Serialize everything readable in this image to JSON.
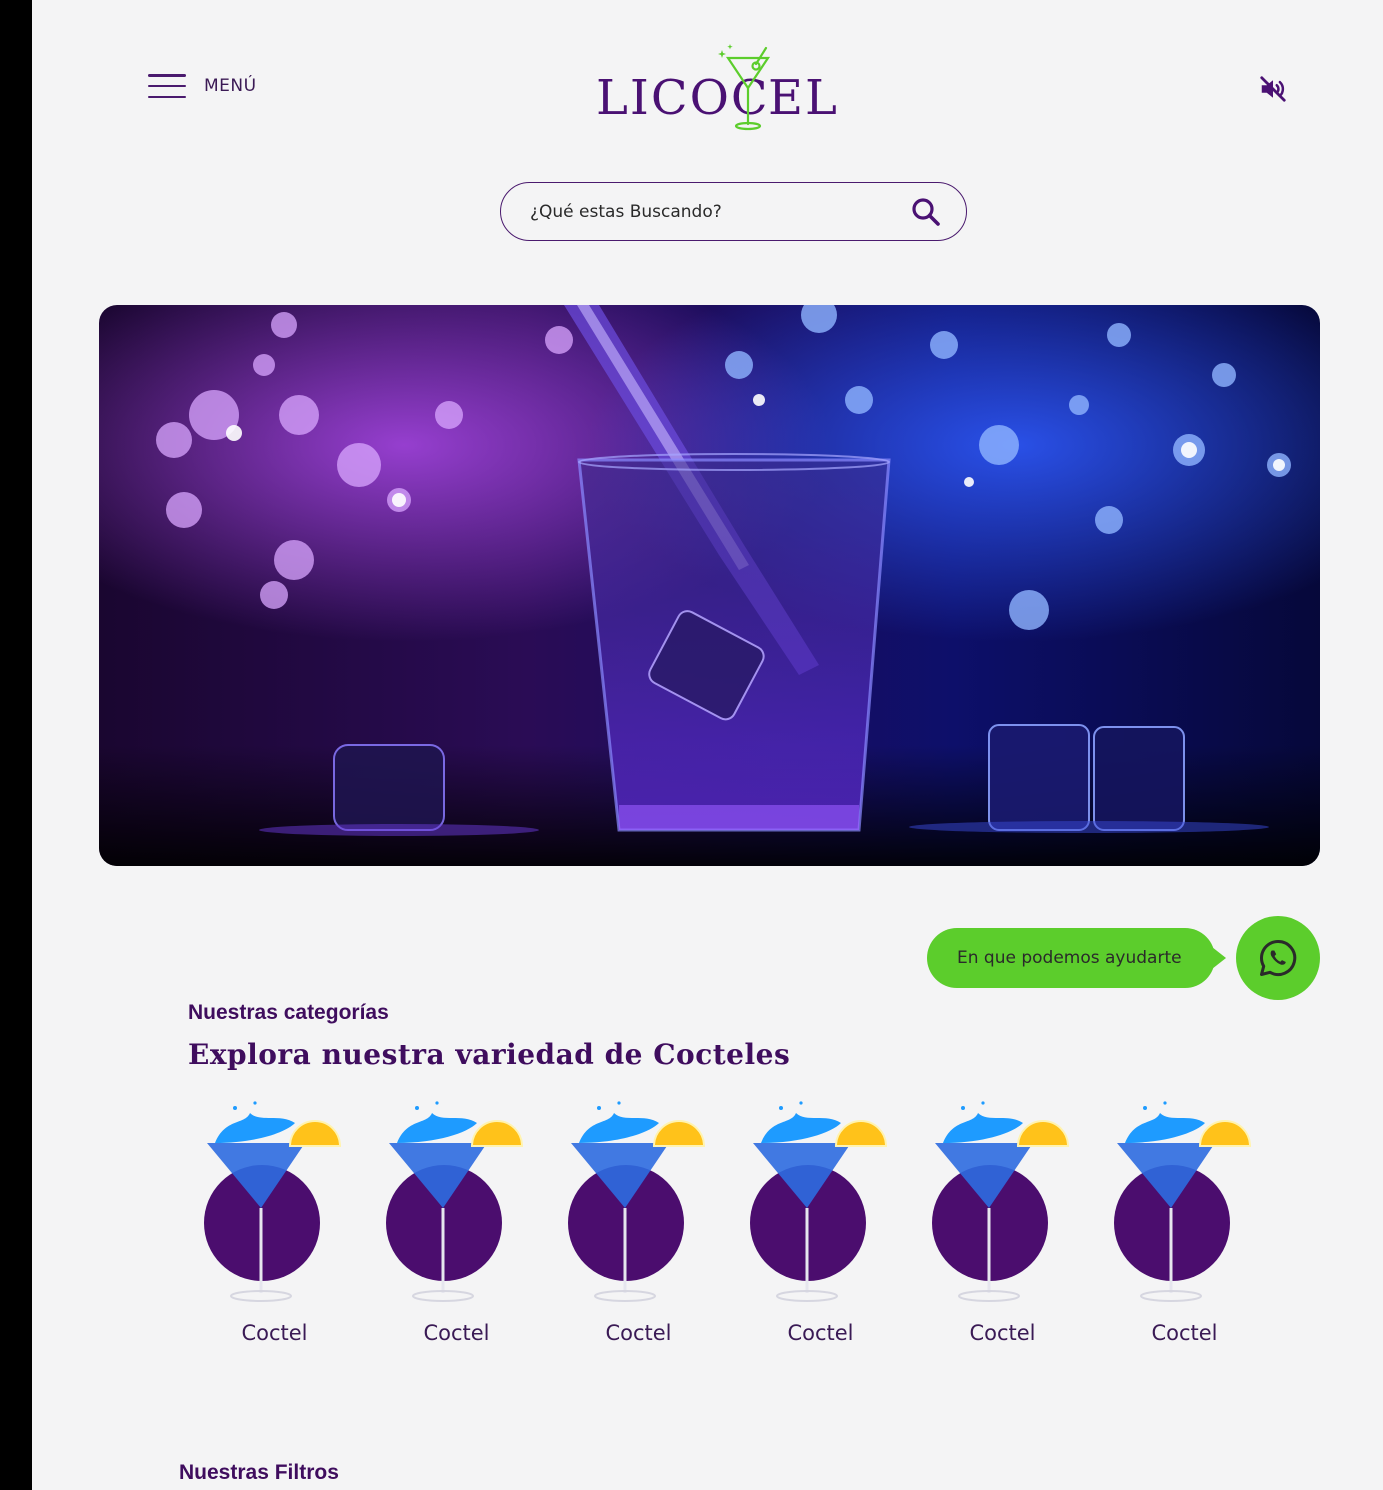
{
  "header": {
    "menu_label": "MENÚ",
    "logo_text_left": "LICOC",
    "logo_text_right": "EL",
    "menu_icon": "hamburger-icon",
    "sound_icon": "volume-mute-icon"
  },
  "search": {
    "placeholder": "¿Qué estas Buscando?",
    "icon": "search-icon"
  },
  "help": {
    "label": "En que podemos ayudarte",
    "icon": "whatsapp-icon",
    "color": "#5ccd2c"
  },
  "categories": {
    "kicker": "Nuestras categorías",
    "title": "Explora nuestra variedad de Cocteles",
    "items": [
      {
        "label": "Coctel"
      },
      {
        "label": "Coctel"
      },
      {
        "label": "Coctel"
      },
      {
        "label": "Coctel"
      },
      {
        "label": "Coctel"
      },
      {
        "label": "Coctel"
      }
    ]
  },
  "filters": {
    "kicker": "Nuestras Filtros"
  },
  "colors": {
    "brand": "#4a1173",
    "accent_green": "#5ccd2c",
    "circle": "#4b0d6e",
    "background": "#f4f4f5"
  }
}
